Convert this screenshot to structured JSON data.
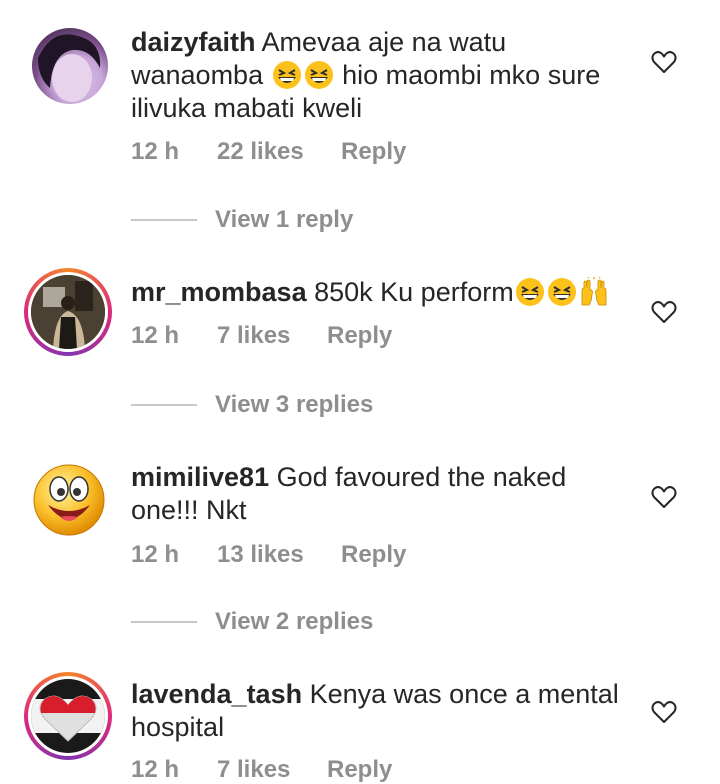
{
  "comments": [
    {
      "username": "daizyfaith",
      "text_before": "Amevaa aje na watu wanaomba",
      "emojis": [
        "grinning-squinting-face-icon",
        "grinning-squinting-face-icon"
      ],
      "text_after": "hio maombi mko sure ilivuka mabati kweli",
      "time": "12 h",
      "likes": "22 likes",
      "reply_label": "Reply",
      "view_replies": "View 1 reply"
    },
    {
      "username": "mr_mombasa",
      "text_before": "850k Ku perform",
      "emojis": [
        "grinning-squinting-face-icon",
        "grinning-squinting-face-icon",
        "raising-hands-icon"
      ],
      "text_after": "",
      "time": "12 h",
      "likes": "7 likes",
      "reply_label": "Reply",
      "view_replies": "View 3 replies"
    },
    {
      "username": "mimilive81",
      "text_before": "God favoured the naked one!!! Nkt",
      "emojis": [],
      "text_after": "",
      "time": "12 h",
      "likes": "13 likes",
      "reply_label": "Reply",
      "view_replies": "View 2 replies"
    },
    {
      "username": "lavenda_tash",
      "text_before": "Kenya was once a mental hospital",
      "emojis": [],
      "text_after": "",
      "time": "12 h",
      "likes": "7 likes",
      "reply_label": "Reply",
      "view_replies": ""
    }
  ],
  "colors": {
    "text": "#262626",
    "meta": "#8e8e8e",
    "divider": "#c7c7c7",
    "story_ring_start": "#f58529",
    "story_ring_end": "#dd2a7b"
  }
}
